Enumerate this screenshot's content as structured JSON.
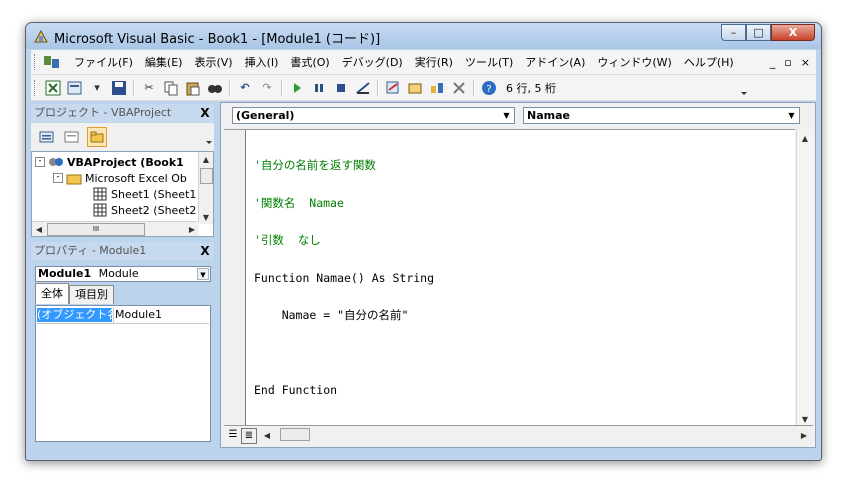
{
  "window": {
    "title": "Microsoft Visual Basic - Book1 - [Module1 (コード)]",
    "caption_minimize": "–",
    "caption_maximize": "□",
    "caption_close": "X"
  },
  "menubar": {
    "items": [
      "ファイル(F)",
      "編集(E)",
      "表示(V)",
      "挿入(I)",
      "書式(O)",
      "デバッグ(D)",
      "実行(R)",
      "ツール(T)",
      "アドイン(A)",
      "ウィンドウ(W)",
      "ヘルプ(H)"
    ],
    "mdi_minimize": "_",
    "mdi_restore": "▫",
    "mdi_close": "×"
  },
  "toolbar": {
    "position_text": "6 行, 5 桁",
    "buttons": [
      "excel-icon",
      "insert-module-icon",
      "save-icon",
      "cut-icon",
      "copy-icon",
      "paste-icon",
      "find-icon",
      "undo-icon",
      "redo-icon",
      "run-icon",
      "break-icon",
      "reset-icon",
      "design-mode-icon",
      "project-explorer-icon",
      "properties-icon",
      "object-browser-icon",
      "toolbox-icon",
      "help-icon"
    ]
  },
  "project_panel": {
    "title": "プロジェクト - VBAProject",
    "close": "X",
    "tree": [
      {
        "label": "VBAProject (Book1",
        "bold": true
      },
      {
        "label": "Microsoft Excel Ob"
      },
      {
        "label": "Sheet1 (Sheet1"
      },
      {
        "label": "Sheet2 (Sheet2"
      }
    ],
    "hscroll_thumb": "III"
  },
  "properties_panel": {
    "title": "プロパティ - Module1",
    "close": "X",
    "object_name": "Module1",
    "object_type": "Module",
    "tabs": [
      "全体",
      "項目別"
    ],
    "property_name": "(オブジェクト名)",
    "property_value": "Module1"
  },
  "code_window": {
    "object_combo": "(General)",
    "procedure_combo": "Namae",
    "lines": [
      {
        "text": "'自分の名前を返す関数",
        "comment": true
      },
      {
        "text": "'関数名  Namae",
        "comment": true
      },
      {
        "text": "'引数  なし",
        "comment": true
      },
      {
        "text": "Function Namae() As String",
        "comment": false
      },
      {
        "text": "    Namae = \"自分の名前\"",
        "comment": false
      },
      {
        "text": "",
        "comment": false
      },
      {
        "text": "End Function",
        "comment": false
      }
    ]
  }
}
